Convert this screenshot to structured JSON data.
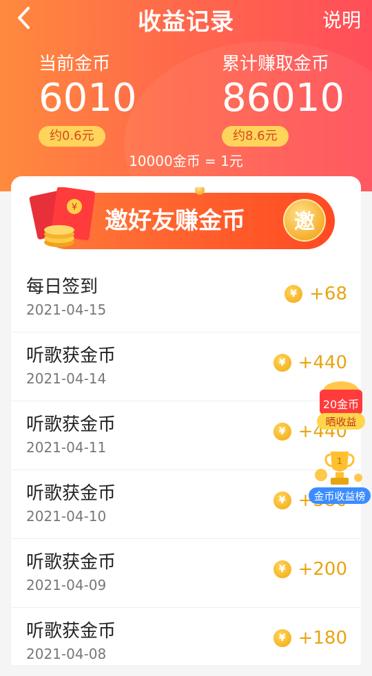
{
  "header": {
    "title": "收益记录",
    "help_label": "说明",
    "current": {
      "label": "当前金币",
      "value": "6010",
      "approx": "约0.6元"
    },
    "total": {
      "label": "累计赚取金币",
      "value": "86010",
      "approx": "约8.6元"
    },
    "rate": "10000金币 = 1元"
  },
  "banner": {
    "text": "邀好友赚金币",
    "badge": "邀"
  },
  "records": [
    {
      "title": "每日签到",
      "date": "2021-04-15",
      "amount": "+68"
    },
    {
      "title": "听歌获金币",
      "date": "2021-04-14",
      "amount": "+440"
    },
    {
      "title": "听歌获金币",
      "date": "2021-04-11",
      "amount": "+440"
    },
    {
      "title": "听歌获金币",
      "date": "2021-04-10",
      "amount": "+380"
    },
    {
      "title": "听歌获金币",
      "date": "2021-04-09",
      "amount": "+200"
    },
    {
      "title": "听歌获金币",
      "date": "2021-04-08",
      "amount": "+180"
    }
  ],
  "floating": {
    "share": {
      "coins": "20金币",
      "label": "晒收益"
    },
    "ranking": {
      "label": "金币收益榜",
      "rank": "1"
    }
  },
  "coin_symbol": "¥",
  "colors": {
    "accent": "#ff5a4e",
    "gold": "#e8a411"
  }
}
